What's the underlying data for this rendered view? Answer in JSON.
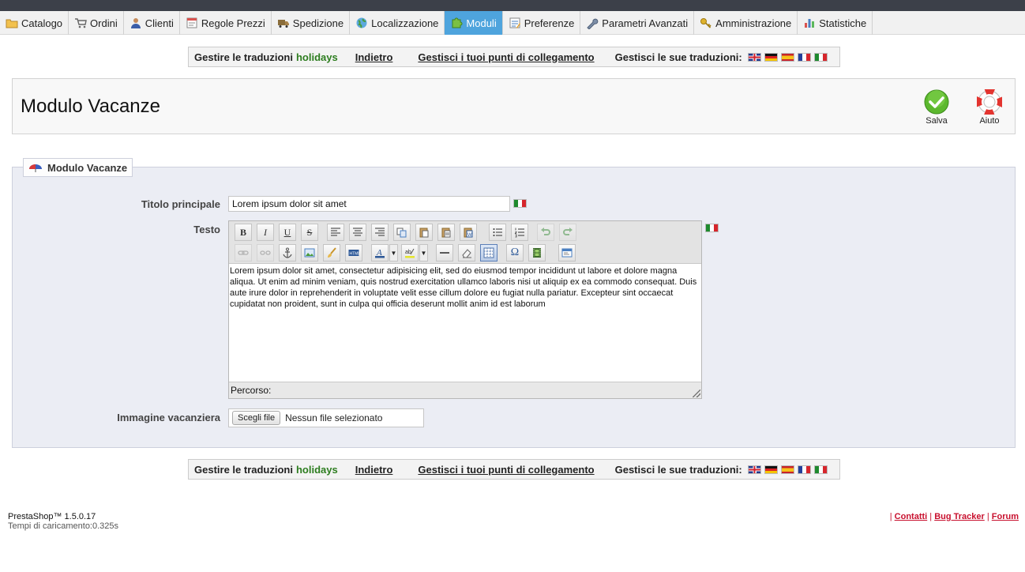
{
  "nav": {
    "tabs": [
      {
        "label": "Catalogo",
        "icon": "folder-icon"
      },
      {
        "label": "Ordini",
        "icon": "cart-icon"
      },
      {
        "label": "Clienti",
        "icon": "user-icon"
      },
      {
        "label": "Regole Prezzi",
        "icon": "price-rules-icon"
      },
      {
        "label": "Spedizione",
        "icon": "truck-icon"
      },
      {
        "label": "Localizzazione",
        "icon": "globe-icon"
      },
      {
        "label": "Moduli",
        "icon": "puzzle-icon",
        "active": true
      },
      {
        "label": "Preferenze",
        "icon": "preferences-icon"
      },
      {
        "label": "Parametri Avanzati",
        "icon": "wrench-icon"
      },
      {
        "label": "Amministrazione",
        "icon": "key-icon"
      },
      {
        "label": "Statistiche",
        "icon": "bar-chart-icon"
      }
    ],
    "active_color": "#4ea4dd"
  },
  "translations_bar": {
    "manage_label": "Gestire le traduzioni",
    "module_name": "holidays",
    "back_link": "Indietro",
    "hooks_link": "Gestisci i tuoi punti di collegamento",
    "its_translations_label": "Gestisci le sue traduzioni:",
    "flags": [
      "gb-flag-icon",
      "de-flag-icon",
      "es-flag-icon",
      "fr-flag-icon",
      "it-flag-icon"
    ]
  },
  "header": {
    "title": "Modulo Vacanze",
    "save_label": "Salva",
    "help_label": "Aiuto"
  },
  "form": {
    "legend": "Modulo Vacanze",
    "title_label": "Titolo principale",
    "title_value": "Lorem ipsum dolor sit amet",
    "text_label": "Testo",
    "text_value": "Lorem ipsum dolor sit amet, consectetur adipisicing elit, sed do eiusmod tempor incididunt ut labore et dolore magna aliqua. Ut enim ad minim veniam, quis nostrud exercitation ullamco laboris nisi ut aliquip ex ea commodo consequat. Duis aute irure dolor in reprehenderit in voluptate velit esse cillum dolore eu fugiat nulla pariatur. Excepteur sint occaecat cupidatat non proident, sunt in culpa qui officia deserunt mollit anim id est laborum",
    "path_label": "Percorso:",
    "image_label": "Immagine vacanziera",
    "file_button": "Scegli file",
    "file_status": "Nessun file selezionato"
  },
  "editor_toolbar": {
    "bold": "B",
    "italic": "I",
    "underline": "U",
    "strike": "S",
    "omega": "Ω"
  },
  "footer": {
    "version": "PrestaShop™ 1.5.0.17",
    "load_time": "Tempi di caricamento:0.325s",
    "separator": "|",
    "links": [
      "Contatti",
      "Bug Tracker",
      "Forum"
    ]
  }
}
